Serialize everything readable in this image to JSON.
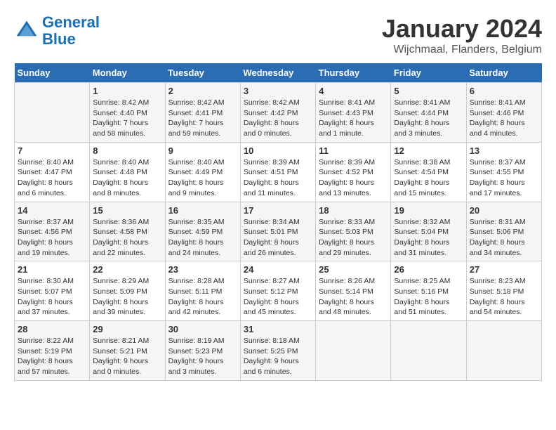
{
  "header": {
    "logo_line1": "General",
    "logo_line2": "Blue",
    "title": "January 2024",
    "subtitle": "Wijchmaal, Flanders, Belgium"
  },
  "days_of_week": [
    "Sunday",
    "Monday",
    "Tuesday",
    "Wednesday",
    "Thursday",
    "Friday",
    "Saturday"
  ],
  "weeks": [
    [
      {
        "day": "",
        "details": ""
      },
      {
        "day": "1",
        "details": "Sunrise: 8:42 AM\nSunset: 4:40 PM\nDaylight: 7 hours\nand 58 minutes."
      },
      {
        "day": "2",
        "details": "Sunrise: 8:42 AM\nSunset: 4:41 PM\nDaylight: 7 hours\nand 59 minutes."
      },
      {
        "day": "3",
        "details": "Sunrise: 8:42 AM\nSunset: 4:42 PM\nDaylight: 8 hours\nand 0 minutes."
      },
      {
        "day": "4",
        "details": "Sunrise: 8:41 AM\nSunset: 4:43 PM\nDaylight: 8 hours\nand 1 minute."
      },
      {
        "day": "5",
        "details": "Sunrise: 8:41 AM\nSunset: 4:44 PM\nDaylight: 8 hours\nand 3 minutes."
      },
      {
        "day": "6",
        "details": "Sunrise: 8:41 AM\nSunset: 4:46 PM\nDaylight: 8 hours\nand 4 minutes."
      }
    ],
    [
      {
        "day": "7",
        "details": "Sunrise: 8:40 AM\nSunset: 4:47 PM\nDaylight: 8 hours\nand 6 minutes."
      },
      {
        "day": "8",
        "details": "Sunrise: 8:40 AM\nSunset: 4:48 PM\nDaylight: 8 hours\nand 8 minutes."
      },
      {
        "day": "9",
        "details": "Sunrise: 8:40 AM\nSunset: 4:49 PM\nDaylight: 8 hours\nand 9 minutes."
      },
      {
        "day": "10",
        "details": "Sunrise: 8:39 AM\nSunset: 4:51 PM\nDaylight: 8 hours\nand 11 minutes."
      },
      {
        "day": "11",
        "details": "Sunrise: 8:39 AM\nSunset: 4:52 PM\nDaylight: 8 hours\nand 13 minutes."
      },
      {
        "day": "12",
        "details": "Sunrise: 8:38 AM\nSunset: 4:54 PM\nDaylight: 8 hours\nand 15 minutes."
      },
      {
        "day": "13",
        "details": "Sunrise: 8:37 AM\nSunset: 4:55 PM\nDaylight: 8 hours\nand 17 minutes."
      }
    ],
    [
      {
        "day": "14",
        "details": "Sunrise: 8:37 AM\nSunset: 4:56 PM\nDaylight: 8 hours\nand 19 minutes."
      },
      {
        "day": "15",
        "details": "Sunrise: 8:36 AM\nSunset: 4:58 PM\nDaylight: 8 hours\nand 22 minutes."
      },
      {
        "day": "16",
        "details": "Sunrise: 8:35 AM\nSunset: 4:59 PM\nDaylight: 8 hours\nand 24 minutes."
      },
      {
        "day": "17",
        "details": "Sunrise: 8:34 AM\nSunset: 5:01 PM\nDaylight: 8 hours\nand 26 minutes."
      },
      {
        "day": "18",
        "details": "Sunrise: 8:33 AM\nSunset: 5:03 PM\nDaylight: 8 hours\nand 29 minutes."
      },
      {
        "day": "19",
        "details": "Sunrise: 8:32 AM\nSunset: 5:04 PM\nDaylight: 8 hours\nand 31 minutes."
      },
      {
        "day": "20",
        "details": "Sunrise: 8:31 AM\nSunset: 5:06 PM\nDaylight: 8 hours\nand 34 minutes."
      }
    ],
    [
      {
        "day": "21",
        "details": "Sunrise: 8:30 AM\nSunset: 5:07 PM\nDaylight: 8 hours\nand 37 minutes."
      },
      {
        "day": "22",
        "details": "Sunrise: 8:29 AM\nSunset: 5:09 PM\nDaylight: 8 hours\nand 39 minutes."
      },
      {
        "day": "23",
        "details": "Sunrise: 8:28 AM\nSunset: 5:11 PM\nDaylight: 8 hours\nand 42 minutes."
      },
      {
        "day": "24",
        "details": "Sunrise: 8:27 AM\nSunset: 5:12 PM\nDaylight: 8 hours\nand 45 minutes."
      },
      {
        "day": "25",
        "details": "Sunrise: 8:26 AM\nSunset: 5:14 PM\nDaylight: 8 hours\nand 48 minutes."
      },
      {
        "day": "26",
        "details": "Sunrise: 8:25 AM\nSunset: 5:16 PM\nDaylight: 8 hours\nand 51 minutes."
      },
      {
        "day": "27",
        "details": "Sunrise: 8:23 AM\nSunset: 5:18 PM\nDaylight: 8 hours\nand 54 minutes."
      }
    ],
    [
      {
        "day": "28",
        "details": "Sunrise: 8:22 AM\nSunset: 5:19 PM\nDaylight: 8 hours\nand 57 minutes."
      },
      {
        "day": "29",
        "details": "Sunrise: 8:21 AM\nSunset: 5:21 PM\nDaylight: 9 hours\nand 0 minutes."
      },
      {
        "day": "30",
        "details": "Sunrise: 8:19 AM\nSunset: 5:23 PM\nDaylight: 9 hours\nand 3 minutes."
      },
      {
        "day": "31",
        "details": "Sunrise: 8:18 AM\nSunset: 5:25 PM\nDaylight: 9 hours\nand 6 minutes."
      },
      {
        "day": "",
        "details": ""
      },
      {
        "day": "",
        "details": ""
      },
      {
        "day": "",
        "details": ""
      }
    ]
  ]
}
